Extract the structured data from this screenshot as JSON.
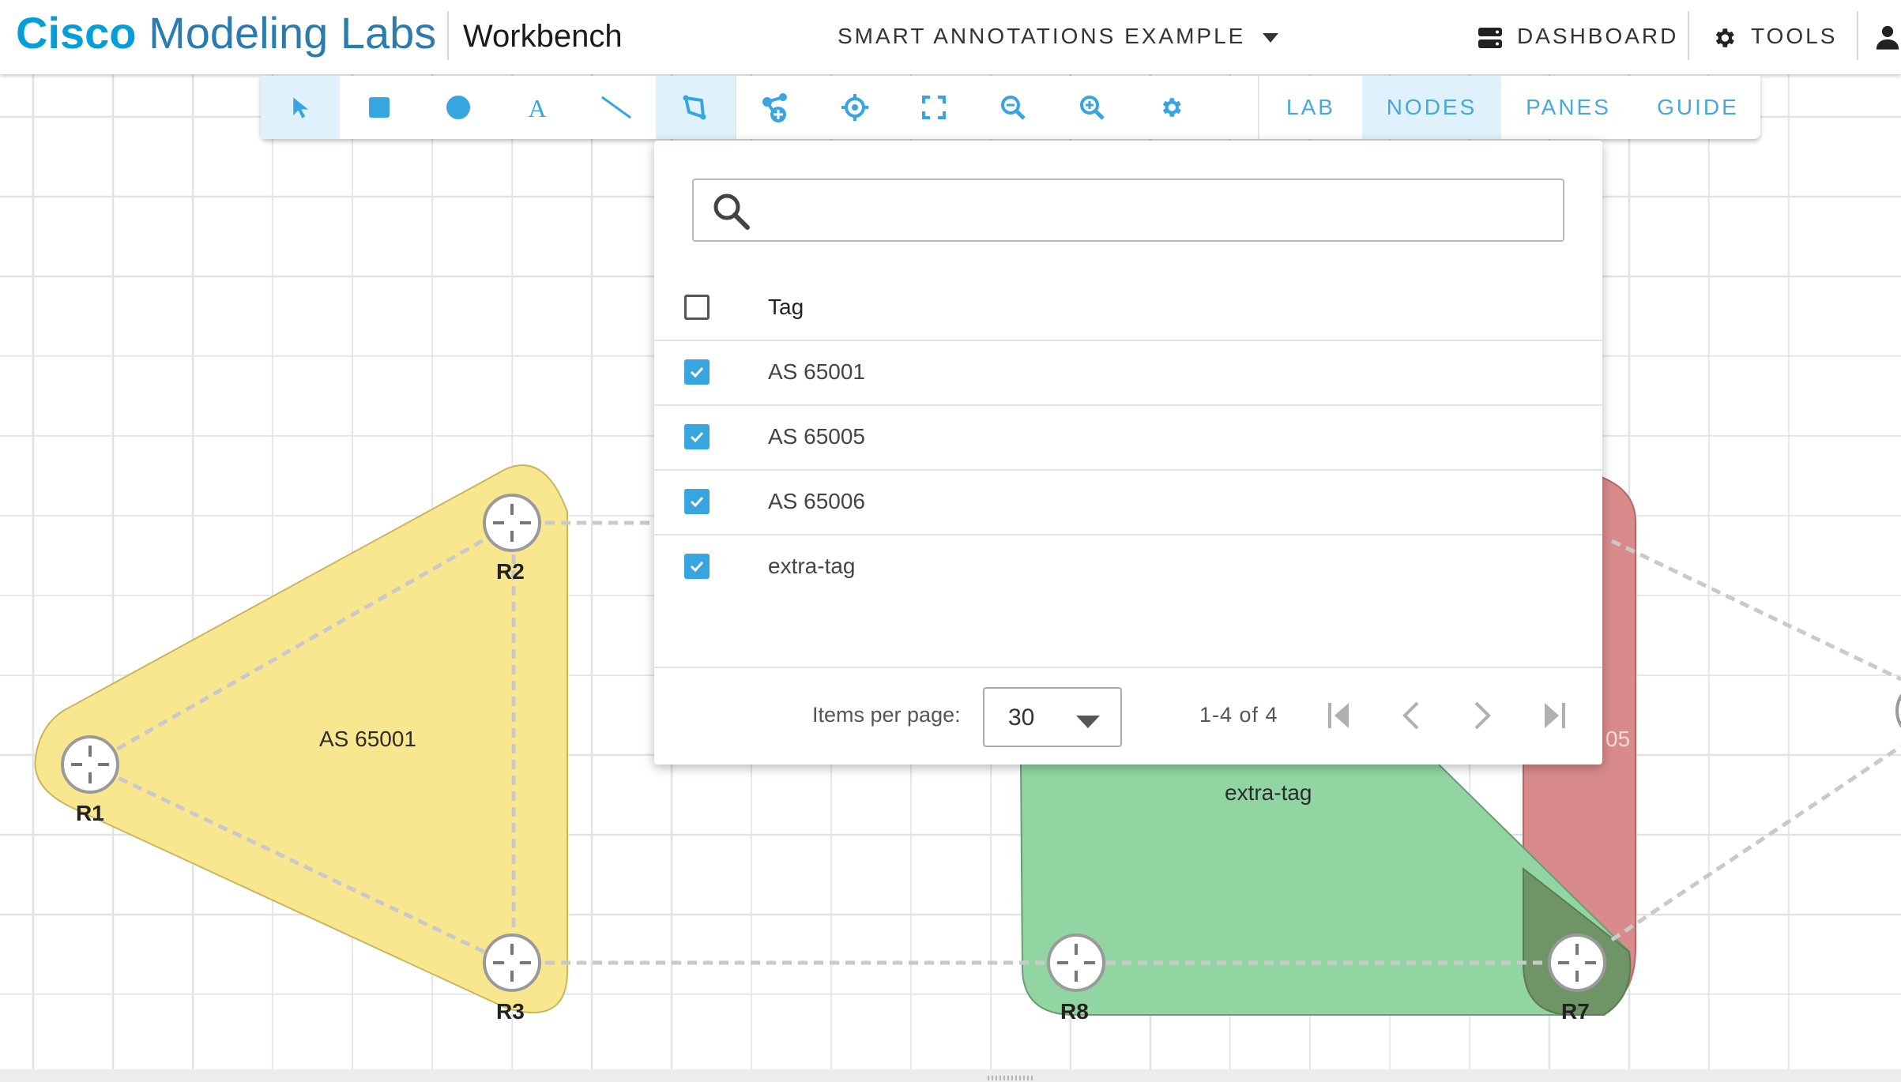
{
  "header": {
    "brand_bold": "Cisco",
    "brand_rest": "Modeling Labs",
    "workbench": "Workbench",
    "lab_title": "SMART ANNOTATIONS EXAMPLE",
    "dashboard": "DASHBOARD",
    "tools": "TOOLS"
  },
  "toolbar": {
    "tools": [
      {
        "name": "select-tool",
        "icon": "cursor-icon",
        "active": true
      },
      {
        "name": "rectangle-tool",
        "icon": "rectangle-icon",
        "active": false
      },
      {
        "name": "ellipse-tool",
        "icon": "circle-icon",
        "active": false
      },
      {
        "name": "text-tool",
        "icon": "text-icon",
        "active": false
      },
      {
        "name": "line-tool",
        "icon": "line-icon",
        "active": false
      },
      {
        "name": "smart-annotation-tool",
        "icon": "smart-annotation-icon",
        "active": true
      },
      {
        "name": "add-node-tool",
        "icon": "add-node-icon",
        "active": false
      },
      {
        "name": "center-tool",
        "icon": "crosshair-icon",
        "active": false
      },
      {
        "name": "fit-tool",
        "icon": "fit-screen-icon",
        "active": false
      },
      {
        "name": "zoom-out-tool",
        "icon": "zoom-out-icon",
        "active": false
      },
      {
        "name": "zoom-in-tool",
        "icon": "zoom-in-icon",
        "active": false
      },
      {
        "name": "settings-tool",
        "icon": "gear-icon",
        "active": false
      }
    ],
    "tabs": {
      "lab": "LAB",
      "nodes": "NODES",
      "panes": "PANES",
      "guide": "GUIDE"
    },
    "accent": "#4aa8d8"
  },
  "tag_filter": {
    "search_value": "",
    "header": "Tag",
    "rows": [
      {
        "label": "AS 65001",
        "checked": true
      },
      {
        "label": "AS 65005",
        "checked": true
      },
      {
        "label": "AS 65006",
        "checked": true
      },
      {
        "label": "extra-tag",
        "checked": true
      }
    ],
    "items_per_page_label": "Items per page:",
    "items_per_page": "30",
    "range": "1-4 of 4"
  },
  "canvas": {
    "nodes": {
      "r1": "R1",
      "r2": "R2",
      "r3": "R3",
      "r7": "R7",
      "r8": "R8"
    },
    "regions": {
      "as65001": "AS 65001",
      "extra_tag": "extra-tag",
      "as65005_partial": "05"
    },
    "colors": {
      "yellow_region": "#f9e78f",
      "green_region": "#91d6a2",
      "red_region": "#d98b8b"
    }
  }
}
